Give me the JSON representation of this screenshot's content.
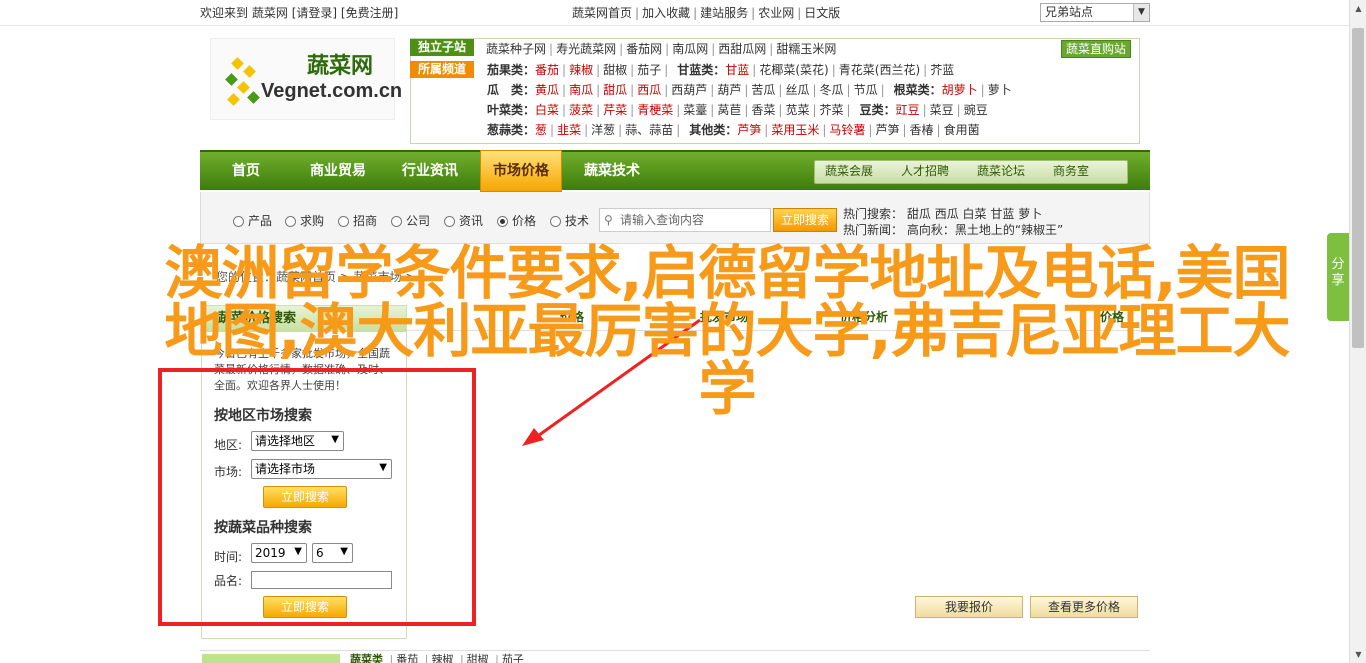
{
  "topbar": {
    "welcome": "欢迎来到",
    "site_name": "蔬菜网",
    "login": "[请登录]",
    "register": "[免费注册]",
    "links": [
      "蔬菜网首页",
      "加入收藏",
      "建站服务",
      "农业网",
      "日文版"
    ],
    "site_select": "兄弟站点"
  },
  "logo": {
    "cn": "蔬菜网",
    "en": "Vegnet.com.cn"
  },
  "header": {
    "tag1": "独立子站",
    "tag2": "所属频道",
    "subsites": [
      "蔬菜种子网",
      "寿光蔬菜网",
      "番茄网",
      "南瓜网",
      "西甜瓜网",
      "甜糯玉米网"
    ],
    "direct_btn": "蔬菜直购站",
    "rows": [
      {
        "label": "茄果类：",
        "items": [
          "番茄",
          "辣椒",
          "甜椒",
          "茄子"
        ],
        "label2": "甘蓝类：",
        "items2": [
          "甘蓝",
          "花椰菜(菜花)",
          "青花菜(西兰花)",
          "芥蓝"
        ]
      },
      {
        "label": "瓜　类：",
        "items": [
          "黄瓜",
          "南瓜",
          "甜瓜",
          "西瓜",
          "西葫芦",
          "葫芦",
          "苦瓜",
          "丝瓜",
          "冬瓜",
          "节瓜"
        ],
        "label2": "根菜类：",
        "items2": [
          "胡萝卜",
          "萝卜"
        ]
      },
      {
        "label": "叶菜类：",
        "items": [
          "白菜",
          "菠菜",
          "芹菜",
          "青梗菜",
          "菜薹",
          "莴苣",
          "香菜",
          "苋菜",
          "芥菜"
        ],
        "label2": "豆类：",
        "items2": [
          "豇豆",
          "菜豆",
          "豌豆"
        ]
      },
      {
        "label": "葱蒜类：",
        "items": [
          "葱",
          "韭菜",
          "洋葱",
          "蒜、蒜苗"
        ],
        "label2": "其他类：",
        "items2": [
          "芦笋",
          "菜用玉米",
          "马铃薯",
          "芦笋",
          "香椿",
          "食用菌"
        ]
      }
    ]
  },
  "nav": {
    "items": [
      "首页",
      "商业贸易",
      "行业资讯",
      "市场价格",
      "蔬菜技术"
    ],
    "sub": [
      "蔬菜会展",
      "人才招聘",
      "蔬菜论坛",
      "商务室"
    ]
  },
  "search": {
    "options": [
      "产品",
      "求购",
      "招商",
      "公司",
      "资讯",
      "价格",
      "技术"
    ],
    "placeholder": "请输入查询内容",
    "button": "立即搜索",
    "hot_label": "热门搜索：",
    "hot_items": [
      "甜瓜",
      "西瓜",
      "白菜",
      "甘蓝",
      "萝卜"
    ],
    "news_label": "热门新闻：",
    "news_text": "高向秋：黑土地上的“辣椒王”"
  },
  "breadcrumb": "您的位置：蔬菜网首页 > 蔬菜市场 >",
  "tabs": [
    "价格",
    "批发市场",
    "价格分析",
    "价格"
  ],
  "left_panel": {
    "title": "蔬菜价格搜索",
    "intro": "今日已有上千多家批发市场，全国蔬菜最新价格行情，数据准确、及时、全面。欢迎各界人士使用！",
    "region_heading": "按地区市场搜索",
    "region_label": "地区:",
    "region_value": "请选择地区",
    "market_label": "市场:",
    "market_value": "请选择市场",
    "search_btn": "立即搜索",
    "variety_heading": "按蔬菜品种搜索",
    "time_label": "时间:",
    "year": "2019",
    "month": "6",
    "name_label": "品名:",
    "search_btn2": "立即搜索"
  },
  "price_buttons": {
    "report": "我要报价",
    "view_more": "查看更多价格"
  },
  "bottom": {
    "items": [
      "蔬菜类",
      "番茄",
      "辣椒",
      "甜椒",
      "茄子"
    ]
  },
  "share": "分享",
  "overlay_title": "澳洲留学条件要求,启德留学地址及电话,美国地图,澳大利亚最厉害的大学,弗吉尼亚理工大学",
  "colors": {
    "overlay": "#f79a1a",
    "nav_green": "#4f8f14",
    "highlight_red": "#ee2222"
  }
}
